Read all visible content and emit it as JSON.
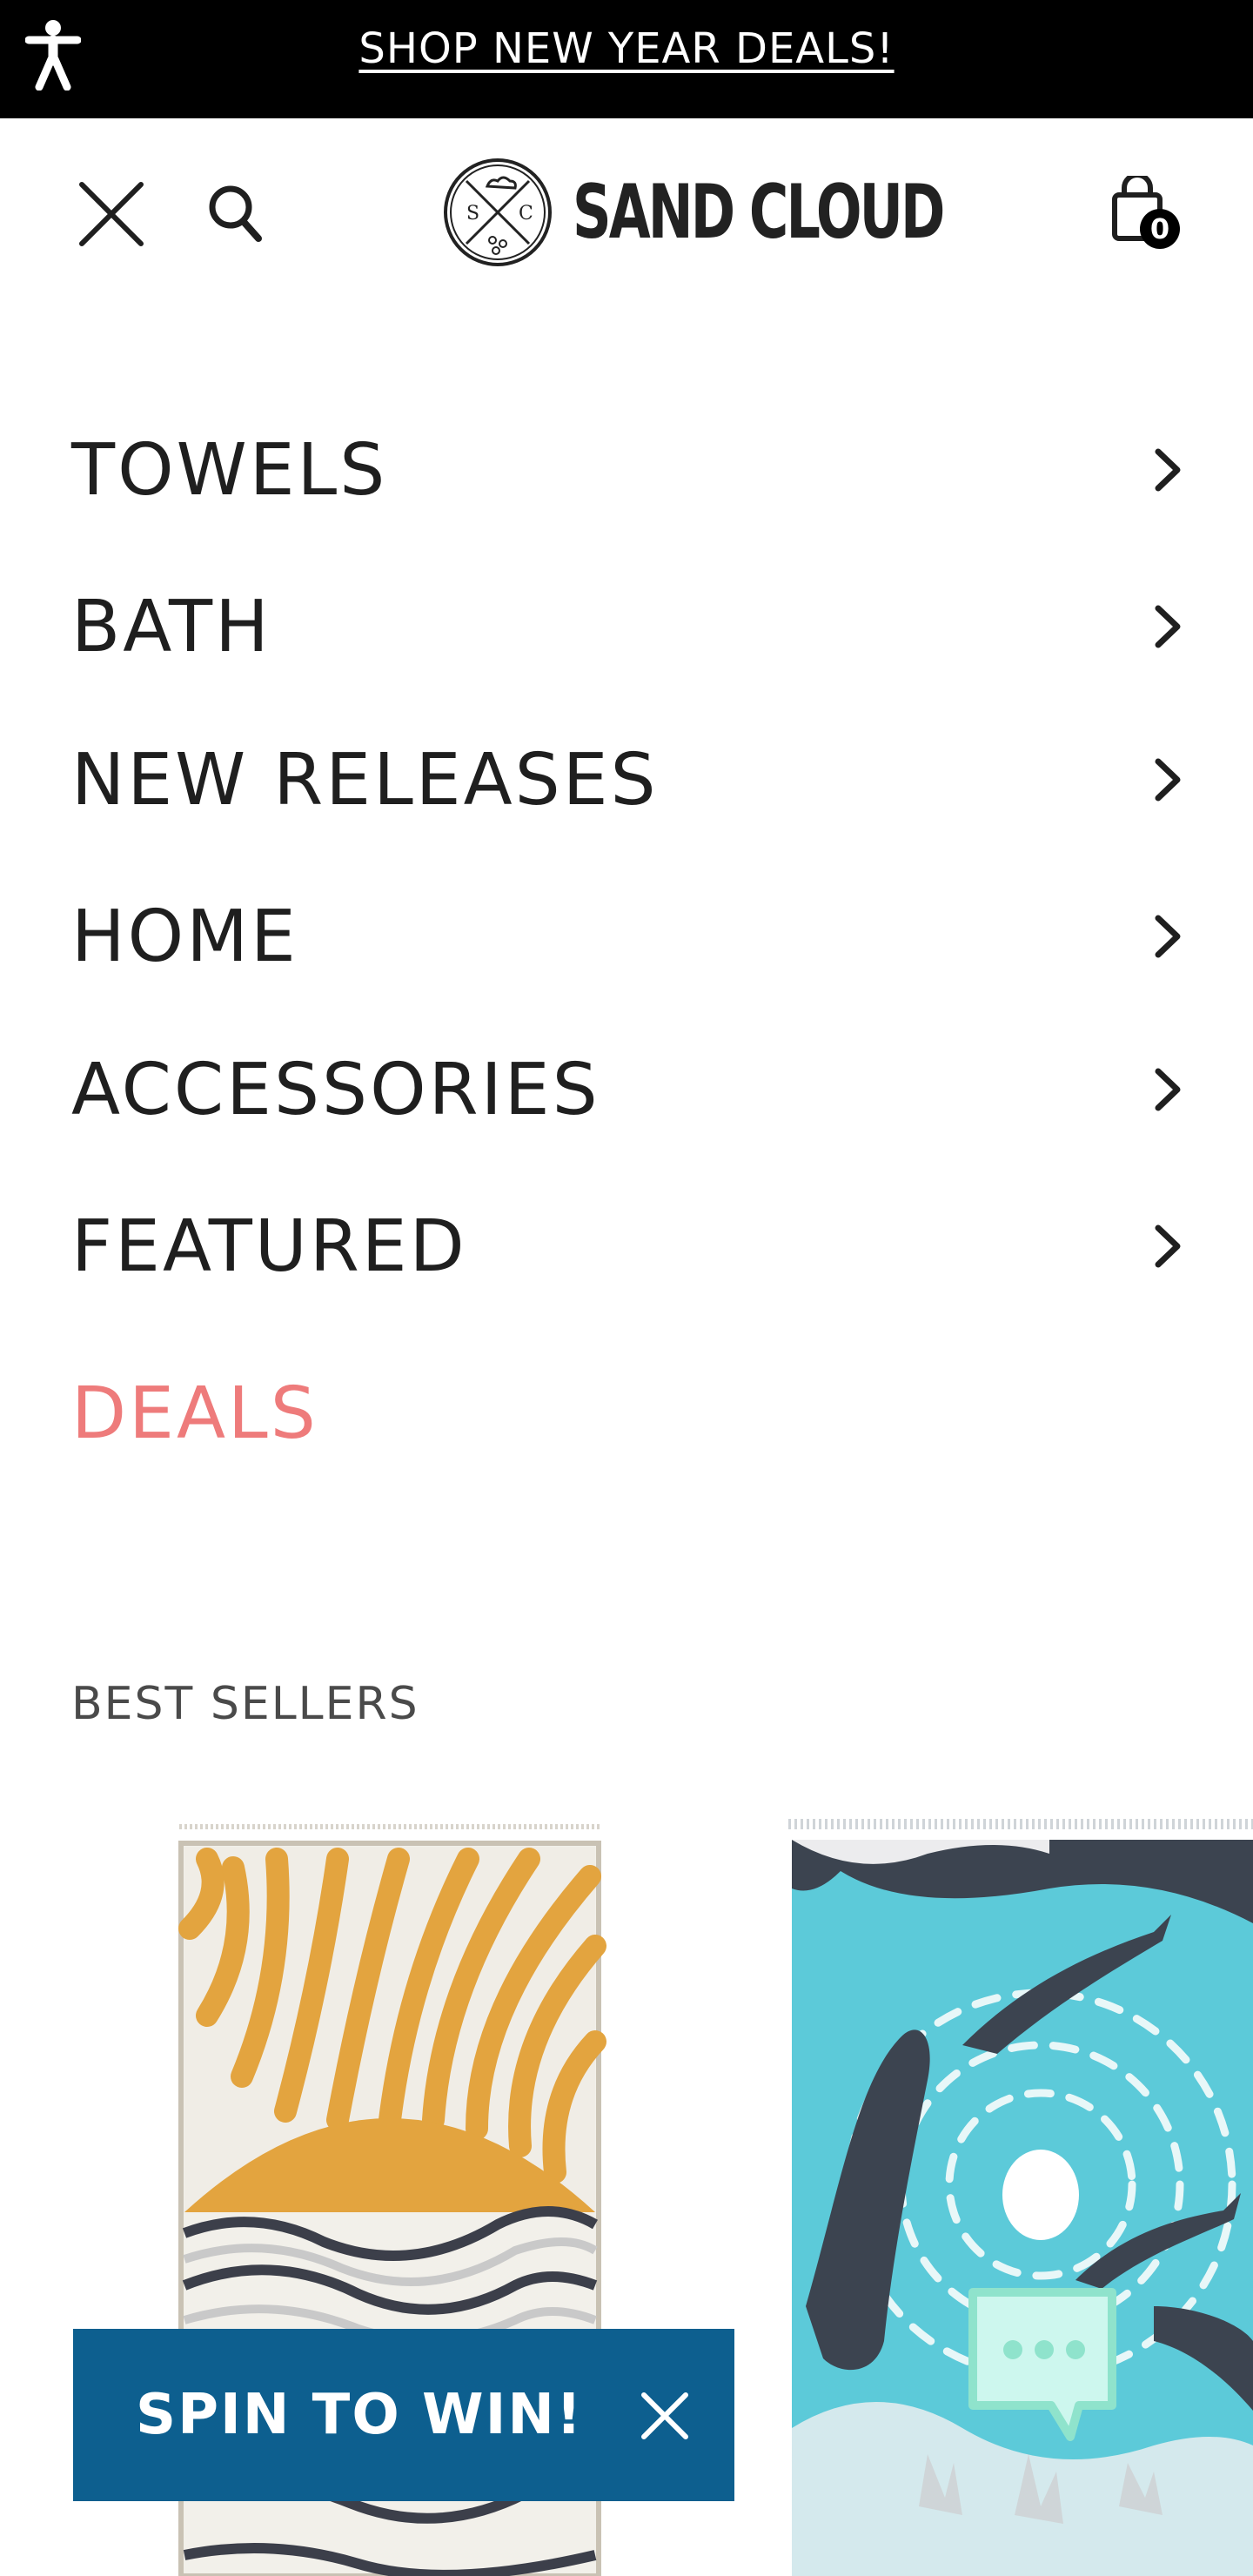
{
  "banner": {
    "text": "SHOP NEW YEAR DEALS!"
  },
  "header": {
    "logo_text": "SAND CLOUD",
    "cart_count": "0"
  },
  "menu": {
    "items": [
      {
        "label": "TOWELS"
      },
      {
        "label": "BATH"
      },
      {
        "label": "NEW RELEASES"
      },
      {
        "label": "HOME"
      },
      {
        "label": "ACCESSORIES"
      },
      {
        "label": "FEATURED"
      }
    ],
    "deals_label": "DEALS"
  },
  "best_sellers": {
    "title": "BEST SELLERS"
  },
  "promo": {
    "label": "SPIN TO WIN!"
  },
  "colors": {
    "banner_bg": "#000000",
    "deals": "#ee7b7b",
    "promo_bg": "#0d5f8f",
    "chat_bg": "#cdf7ee",
    "chat_border": "#8fe3cc"
  },
  "icons": [
    "accessibility-icon",
    "close-icon",
    "search-icon",
    "cart-icon",
    "chevron-right-icon",
    "chat-icon"
  ]
}
